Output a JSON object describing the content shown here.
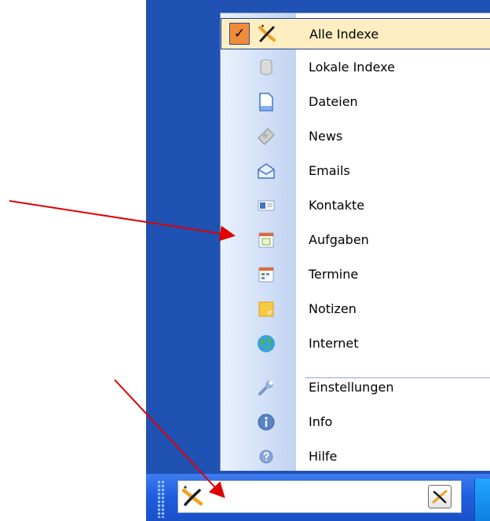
{
  "menu": {
    "items": [
      {
        "label": "Alle Indexe",
        "icon": "cross-logo-icon",
        "selected": true,
        "checked": true
      },
      {
        "label": "Lokale Indexe",
        "icon": "database-icon"
      },
      {
        "label": "Dateien",
        "icon": "document-icon"
      },
      {
        "label": "News",
        "icon": "news-tag-icon"
      },
      {
        "label": "Emails",
        "icon": "envelope-icon"
      },
      {
        "label": "Kontakte",
        "icon": "contact-card-icon"
      },
      {
        "label": "Aufgaben",
        "icon": "task-calendar-icon"
      },
      {
        "label": "Termine",
        "icon": "calendar-grid-icon"
      },
      {
        "label": "Notizen",
        "icon": "note-icon"
      },
      {
        "label": "Internet",
        "icon": "globe-icon"
      },
      {
        "label": "Einstellungen",
        "icon": "wrench-icon"
      },
      {
        "label": "Info",
        "icon": "info-icon"
      },
      {
        "label": "Hilfe",
        "icon": "help-icon"
      }
    ],
    "check_glyph": "✓"
  },
  "search": {
    "value": "",
    "placeholder": ""
  },
  "colors": {
    "desktop": "#1f52b3",
    "taskbar": "#1f5ee0",
    "highlight": "#ffeec2",
    "check_bg": "#f08b3a",
    "arrow": "#e00000",
    "logo": "#f0a020"
  }
}
